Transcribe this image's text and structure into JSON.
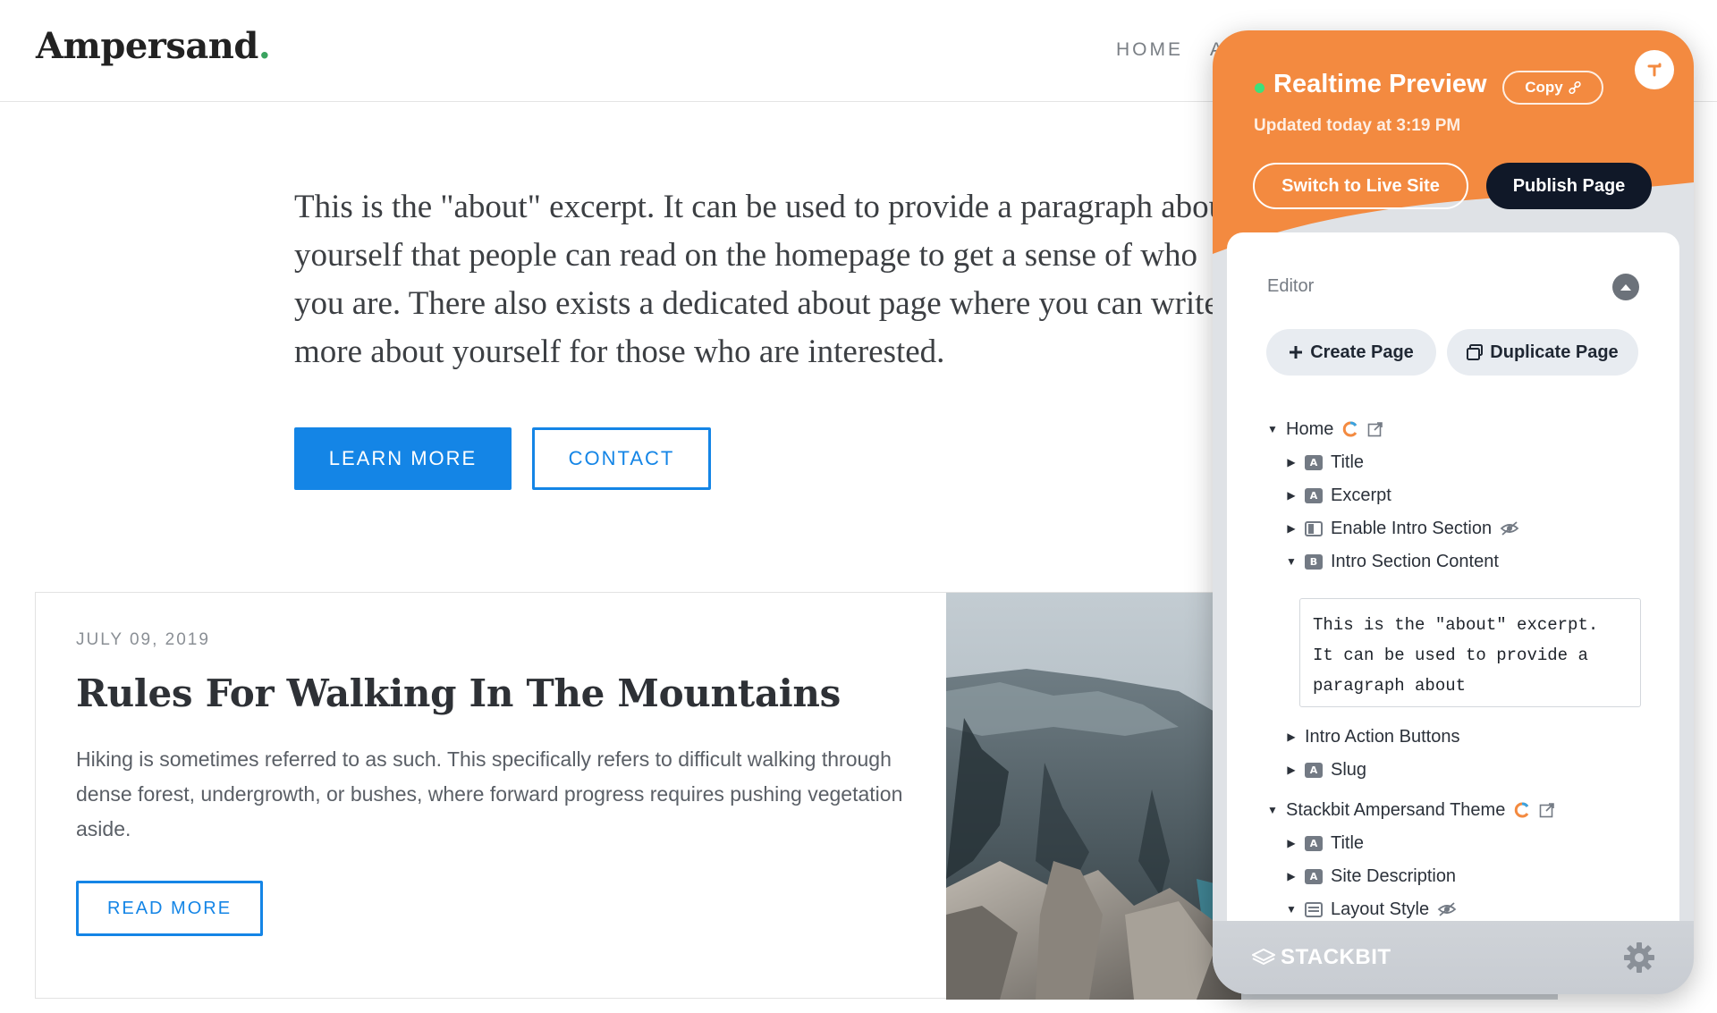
{
  "site": {
    "logo": "Ampersand",
    "logo_dot": ".",
    "nav": [
      "HOME",
      "A"
    ]
  },
  "intro": {
    "text": "This is the \"about\" excerpt. It can be used to provide a paragraph about yourself that people can read on the homepage to get a sense of who you are. There also exists a dedicated about page where you can write more about yourself for those who are interested.",
    "learn_more": "LEARN MORE",
    "contact": "CONTACT"
  },
  "post": {
    "date": "JULY 09, 2019",
    "title": "Rules For Walking In The Mountains",
    "excerpt": "Hiking is sometimes referred to as such. This specifically refers to difficult walking through dense forest, undergrowth, or bushes, where forward progress requires pushing vegetation aside.",
    "read_more": "READ MORE"
  },
  "panel": {
    "title": "Realtime Preview",
    "copy_label": "Copy",
    "updated": "Updated today at 3:19 PM",
    "switch_live": "Switch to Live Site",
    "publish": "Publish Page",
    "editor_label": "Editor",
    "create_page": "Create Page",
    "duplicate_page": "Duplicate Page",
    "tree": {
      "home": "Home",
      "title": "Title",
      "excerpt": "Excerpt",
      "enable_intro": "Enable Intro Section",
      "intro_content": "Intro Section Content",
      "intro_content_value": "This is the \"about\" excerpt. It can be used to provide a paragraph about",
      "intro_buttons": "Intro Action Buttons",
      "slug": "Slug",
      "theme": "Stackbit Ampersand Theme",
      "theme_title": "Title",
      "site_description": "Site Description",
      "layout_style": "Layout Style",
      "layout_style_value": "list"
    },
    "footer_brand": "STACKBIT"
  },
  "colors": {
    "accent": "#1485e6",
    "panel_orange": "#f38a40",
    "publish_dark": "#101828",
    "status_green": "#3ee07a"
  }
}
